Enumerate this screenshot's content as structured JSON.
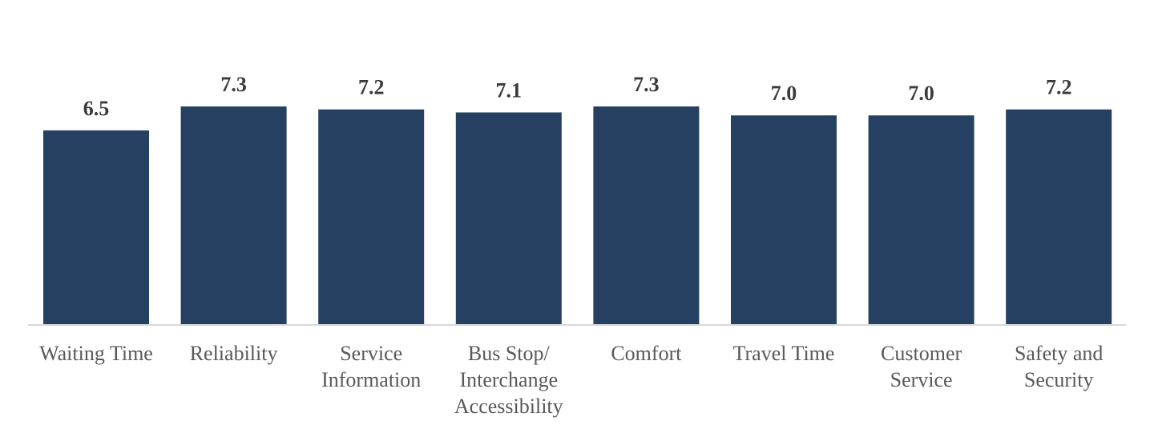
{
  "chart_data": {
    "type": "bar",
    "title": "",
    "xlabel": "",
    "ylabel": "",
    "ylim": [
      0,
      10
    ],
    "grid": false,
    "legend": "none",
    "bar_color": "#264061",
    "categories": [
      [
        "Waiting Time"
      ],
      [
        "Reliability"
      ],
      [
        "Service",
        "Information"
      ],
      [
        "Bus Stop/",
        "Interchange",
        "Accessibility"
      ],
      [
        "Comfort"
      ],
      [
        "Travel Time"
      ],
      [
        "Customer",
        "Service"
      ],
      [
        "Safety and",
        "Security"
      ]
    ],
    "values": [
      6.5,
      7.3,
      7.2,
      7.1,
      7.3,
      7.0,
      7.0,
      7.2
    ],
    "data_labels": [
      "6.5",
      "7.3",
      "7.2",
      "7.1",
      "7.3",
      "7.0",
      "7.0",
      "7.2"
    ]
  }
}
